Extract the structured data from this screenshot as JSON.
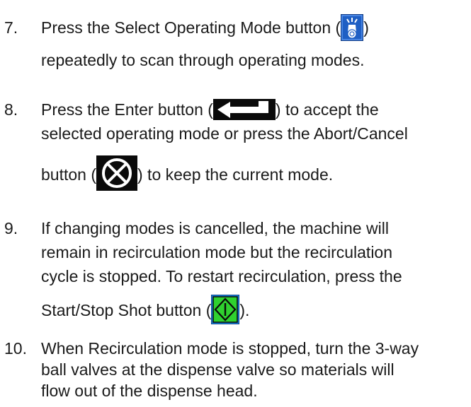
{
  "steps": [
    {
      "number": "7.",
      "line1_pre": "Press the Select Operating Mode button (",
      "line1_post": ")",
      "line2": "repeatedly to scan through operating modes.",
      "icon": "select-operating-mode-icon"
    },
    {
      "number": "8.",
      "line1_pre": "Press the Enter button (",
      "line1_post": ") to accept the",
      "line2": "selected operating mode or press the Abort/Cancel",
      "line3_pre": "button (",
      "line3_post": ") to keep the current mode.",
      "icon_enter": "enter-icon",
      "icon_abort": "abort-cancel-icon"
    },
    {
      "number": "9.",
      "line1": "If changing modes is cancelled, the machine will",
      "line2": "remain in recirculation mode but the recirculation",
      "line3": "cycle is stopped. To restart recirculation, press the",
      "line4_pre": "Start/Stop Shot button (",
      "line4_post": ").",
      "icon": "start-stop-shot-icon"
    },
    {
      "number": "10.",
      "line1": "When Recirculation mode is stopped, turn the 3-way",
      "line2": "ball valves at the dispense valve so materials will",
      "line3": "flow out of the dispense head."
    }
  ],
  "colors": {
    "text": "#1a1a1a",
    "select_icon_bg": "#1f5fc4",
    "start_icon_bg": "#1a7fd8",
    "start_icon_fill": "#2fd12f"
  }
}
